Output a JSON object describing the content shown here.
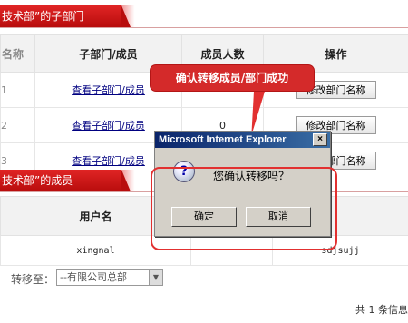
{
  "subdept": {
    "title": "技术部”的子部门",
    "columns": [
      "名称",
      "子部门/成员",
      "成员人数",
      "操作"
    ],
    "rows": [
      {
        "idx": "1",
        "link": "查看子部门/成员",
        "count": "",
        "action": "修改部门名称"
      },
      {
        "idx": "2",
        "link": "查看子部门/成员",
        "count": "0",
        "action": "修改部门名称"
      },
      {
        "idx": "3",
        "link": "查看子部门/成员",
        "count": "",
        "action": "修改部门名称"
      }
    ]
  },
  "callout": "确认转移成员/部门成功",
  "dialog": {
    "title": "Microsoft Internet Explorer",
    "close": "×",
    "icon": "?",
    "message": "您确认转移吗？",
    "ok": "确定",
    "cancel": "取消"
  },
  "members": {
    "title": "技术部”的成员",
    "columns": [
      "用户名",
      "",
      ""
    ],
    "rows": [
      {
        "username": "xingnal",
        "c2": "",
        "c3": "sdjsujj"
      }
    ]
  },
  "transfer": {
    "label": "转移至：",
    "selected": "--有限公司总部"
  },
  "pager": "共 1 条信息"
}
